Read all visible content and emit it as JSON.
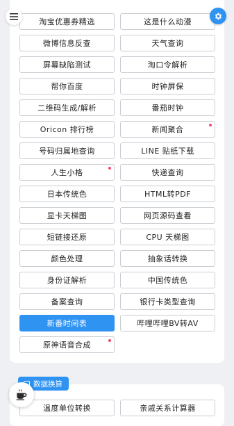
{
  "tools": [
    {
      "label": "淘宝优惠券精选",
      "active": false,
      "dot": false
    },
    {
      "label": "这是什么动漫",
      "active": false,
      "dot": false
    },
    {
      "label": "微博信息反查",
      "active": false,
      "dot": false
    },
    {
      "label": "天气查询",
      "active": false,
      "dot": false
    },
    {
      "label": "屏幕缺陷测试",
      "active": false,
      "dot": false
    },
    {
      "label": "淘口令解析",
      "active": false,
      "dot": false
    },
    {
      "label": "帮你百度",
      "active": false,
      "dot": false
    },
    {
      "label": "时钟屏保",
      "active": false,
      "dot": false
    },
    {
      "label": "二维码生成/解析",
      "active": false,
      "dot": false
    },
    {
      "label": "番茄时钟",
      "active": false,
      "dot": false
    },
    {
      "label": "Oricon 排行榜",
      "active": false,
      "dot": false
    },
    {
      "label": "新闻聚合",
      "active": false,
      "dot": true
    },
    {
      "label": "号码归属地查询",
      "active": false,
      "dot": false
    },
    {
      "label": "LINE 贴纸下载",
      "active": false,
      "dot": false
    },
    {
      "label": "人生小格",
      "active": false,
      "dot": true
    },
    {
      "label": "快递查询",
      "active": false,
      "dot": false
    },
    {
      "label": "日本传统色",
      "active": false,
      "dot": false
    },
    {
      "label": "HTML转PDF",
      "active": false,
      "dot": false
    },
    {
      "label": "显卡天梯图",
      "active": false,
      "dot": false
    },
    {
      "label": "网页源码查看",
      "active": false,
      "dot": false
    },
    {
      "label": "短链接还原",
      "active": false,
      "dot": false
    },
    {
      "label": "CPU 天梯图",
      "active": false,
      "dot": false
    },
    {
      "label": "颜色处理",
      "active": false,
      "dot": false
    },
    {
      "label": "抽象话转换",
      "active": false,
      "dot": false
    },
    {
      "label": "身份证解析",
      "active": false,
      "dot": false
    },
    {
      "label": "中国传统色",
      "active": false,
      "dot": false
    },
    {
      "label": "备案查询",
      "active": false,
      "dot": false
    },
    {
      "label": "银行卡类型查询",
      "active": false,
      "dot": false
    },
    {
      "label": "新番时间表",
      "active": true,
      "dot": false
    },
    {
      "label": "哔哩哔哩BV转AV",
      "active": false,
      "dot": false
    },
    {
      "label": "原神语音合成",
      "active": false,
      "dot": true
    }
  ],
  "section": {
    "label": "数据换算"
  },
  "section_tools": [
    {
      "label": "温度单位转换",
      "active": false,
      "dot": false
    },
    {
      "label": "亲戚关系计算器",
      "active": false,
      "dot": false
    }
  ],
  "icons": {
    "menu": "menu-icon",
    "settings": "gear-icon",
    "section": "section-icon",
    "float": "coffee-icon"
  },
  "colors": {
    "accent": "#2f93f2",
    "dot": "#f24a6a",
    "background": "#eef0f3"
  }
}
